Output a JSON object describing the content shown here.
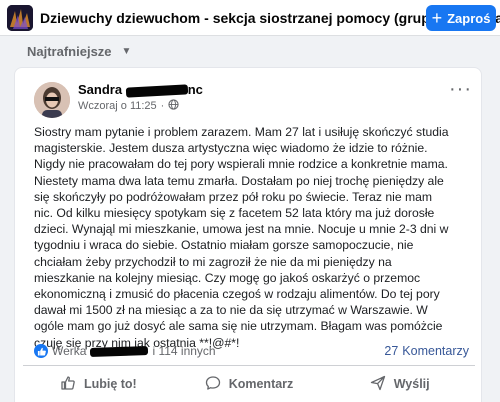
{
  "header": {
    "group_title": "Dziewuchy dziewuchom - sekcja siostrzanej pomocy (grupa prywatna)",
    "invite_label": "Zaproś",
    "invite_icon": "plus-icon"
  },
  "sort": {
    "label": "Najtrafniejsze"
  },
  "post": {
    "author_first": "Sandra",
    "author_tail": "nc",
    "timestamp": "Wczoraj o 11:25",
    "privacy_icon": "globe-icon",
    "lines": [
      "Siostry mam pytanie i problem zarazem. Mam 27 lat i usiłuję skończyć studia",
      "magisterskie. Jestem dusza artystyczna więc wiadomo że idzie to różnie.",
      "Nigdy nie pracowałam do tej pory wspierali mnie rodzice a konkretnie mama.",
      "Niestety mama dwa lata temu zmarła. Dostałam po niej trochę pieniędzy ale",
      "się skończyły po podróżowałam przez pół roku po świecie. Teraz nie mam",
      "nic. Od kilku miesięcy spotykam się z facetem 52 lata który ma już dorosłe",
      "dzieci. Wynająl mi mieszkanie, umowa jest na mnie. Nocuje u mnie 2-3 dni w",
      "tygodniu i wraca do siebie. Ostatnio miałam gorsze samopoczucie, nie",
      "chciałam żeby przychodził to mi zagroził że nie da mi pieniędzy na",
      "mieszkanie na kolejny miesiąc. Czy mogę go jakoś oskarżyć o przemoc",
      "ekonomiczną i zmusić do płacenia czegoś w rodzaju alimentów. Do tej pory",
      "dawał mi 1500 zł na miesiąc a za to nie da się utrzymać w Warszawie. W",
      "ogóle mam go już dosyć ale sama się nie utrzymam. Błagam was pomóżcie",
      "czuję się przy nim jak ostatnia **!@#*!"
    ],
    "reactions_prefix": "Werka",
    "reactions_suffix": "i 114 innych",
    "comments_number": "27",
    "comments_word": "Komentarzy"
  },
  "actions": {
    "like": "Lubię to!",
    "comment": "Komentarz",
    "share": "Wyślij"
  },
  "colors": {
    "accent": "#1877f2",
    "secondary_text": "#65676b",
    "link": "#385898"
  }
}
